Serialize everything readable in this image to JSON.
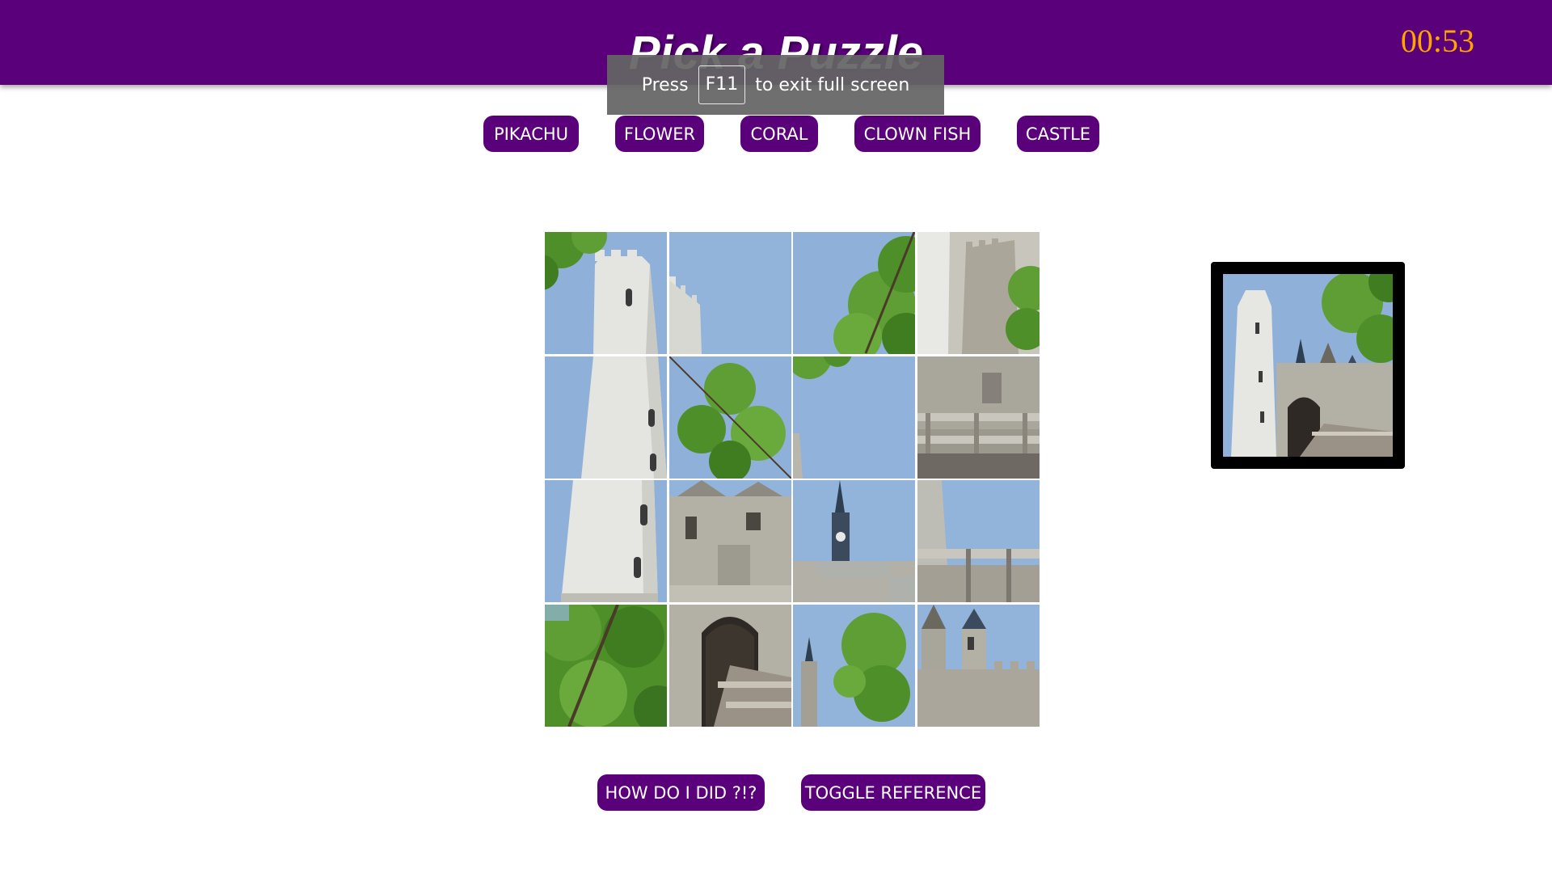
{
  "header": {
    "title": "Pick a Puzzle",
    "timer": "00:53"
  },
  "fullscreen_toast": {
    "prefix": "Press",
    "key": "F11",
    "suffix": "to exit full screen"
  },
  "puzzles": {
    "options": [
      "PIKACHU",
      "FLOWER",
      "CORAL",
      "CLOWN FISH",
      "CASTLE"
    ],
    "selected": "CASTLE"
  },
  "board": {
    "rows": 4,
    "cols": 4,
    "tiles": [
      "tower-top-with-leaves",
      "tower-crenellation-sky",
      "leaves-on-sky",
      "tower-wall-and-ivy",
      "tower-middle-windows",
      "leaves-center",
      "sky-with-spire-edge",
      "bridge-railing-wall",
      "tower-base-window",
      "castle-facade-stone",
      "chapel-spire-clock",
      "railing-and-tower-shadow",
      "tree-foliage",
      "arched-gate-stairs",
      "turret-and-leaves",
      "castle-turrets-battlement"
    ]
  },
  "reference": {
    "visible": true,
    "alt_description": "castle-reference-thumbnail"
  },
  "actions": {
    "check_label": "HOW DO I DID ?!?",
    "toggle_reference_label": "TOGGLE REFERENCE"
  },
  "colors": {
    "header_bg": "#5a007a",
    "button_bg": "#5a007a",
    "timer": "#ffa500",
    "sky": "#8fb0d8",
    "tower_white": "#e4e4e0",
    "stone": "#a8a59a",
    "leaves": "#4f8f2a"
  }
}
